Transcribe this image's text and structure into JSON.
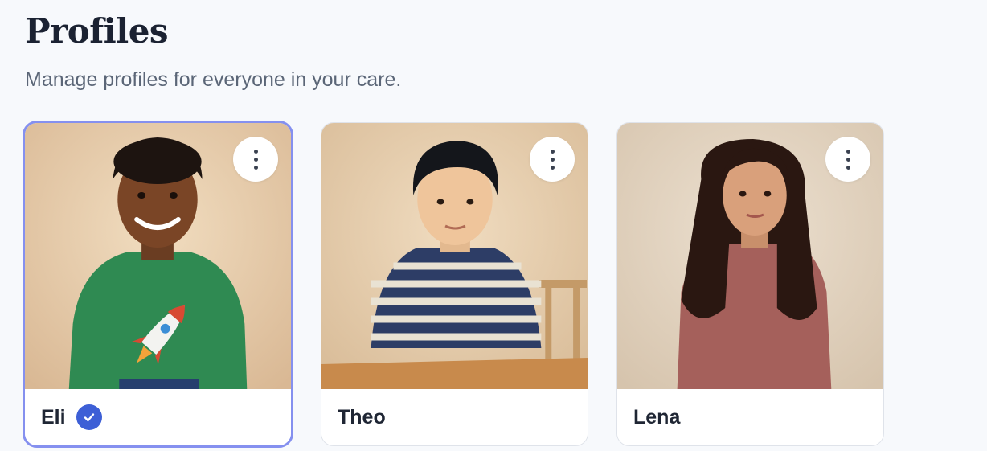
{
  "header": {
    "title": "Profiles",
    "subtitle": "Manage profiles for everyone in your care."
  },
  "profiles": [
    {
      "name": "Eli",
      "selected": true,
      "menu_icon": "more-vertical-icon",
      "status_icon": "check-circle-icon"
    },
    {
      "name": "Theo",
      "selected": false,
      "menu_icon": "more-vertical-icon"
    },
    {
      "name": "Lena",
      "selected": false,
      "menu_icon": "more-vertical-icon"
    }
  ],
  "colors": {
    "selected_border": "#8590ef",
    "check_badge": "#3d5fd6",
    "background": "#f7f9fc"
  }
}
